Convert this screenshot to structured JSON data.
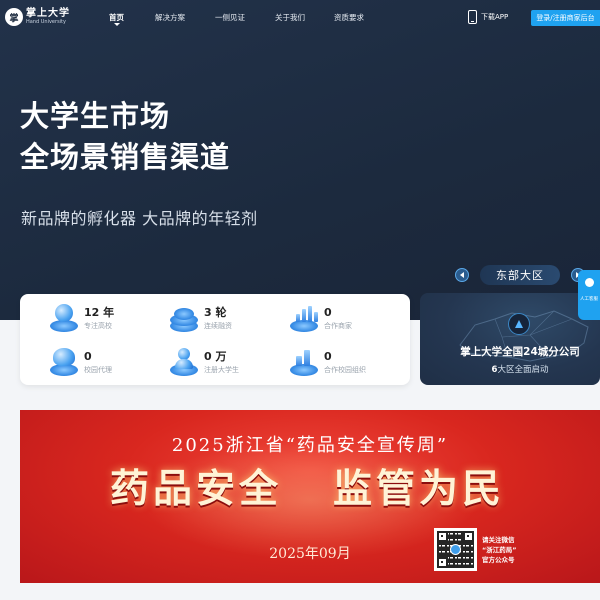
{
  "header": {
    "logo_mark": "掌",
    "logo_cn": "掌上大学",
    "logo_en": "Hand University",
    "nav": [
      {
        "label": "首页",
        "active": true
      },
      {
        "label": "解决方案",
        "active": false
      },
      {
        "label": "一侧见证",
        "active": false
      },
      {
        "label": "关于我们",
        "active": false
      },
      {
        "label": "资质要求",
        "active": false
      }
    ],
    "download_label": "下载APP",
    "login_label": "登录/注册商家后台"
  },
  "hero": {
    "headline_line1": "大学生市场",
    "headline_line2": "全场景销售渠道",
    "subline": "新品牌的孵化器 大品牌的年轻剂"
  },
  "stats": [
    {
      "value": "12 年",
      "label": "专注高校",
      "icon": "disc-orb-icon"
    },
    {
      "value": "3 轮",
      "label": "连续融资",
      "icon": "coins-stack-icon"
    },
    {
      "value": "0",
      "label": "合作商家",
      "icon": "bar-chart-icon"
    },
    {
      "value": "0",
      "label": "校园代理",
      "icon": "cloud-disc-icon"
    },
    {
      "value": "0 万",
      "label": "注册大学生",
      "icon": "user-disc-icon"
    },
    {
      "value": "0",
      "label": "合作校园组织",
      "icon": "building-blocks-icon"
    }
  ],
  "region": {
    "tab_label": "东部大区",
    "title": "掌上大学全国24城分公司",
    "sub_number": "6",
    "sub_text": "大区全面启动"
  },
  "float_service": {
    "label": "人工客服"
  },
  "banner": {
    "title": "2025浙江省“药品安全宣传周”",
    "slogan_left": "药品安全",
    "slogan_right": "监管为民",
    "date": "2025年09月",
    "qr_caption_line1": "请关注微信",
    "qr_caption_line2": "“浙江药局”",
    "qr_caption_line3": "官方公众号"
  },
  "colors": {
    "hero_bg": "#1c2a3e",
    "accent_blue": "#1fa2f0",
    "banner_red": "#d9271f"
  }
}
